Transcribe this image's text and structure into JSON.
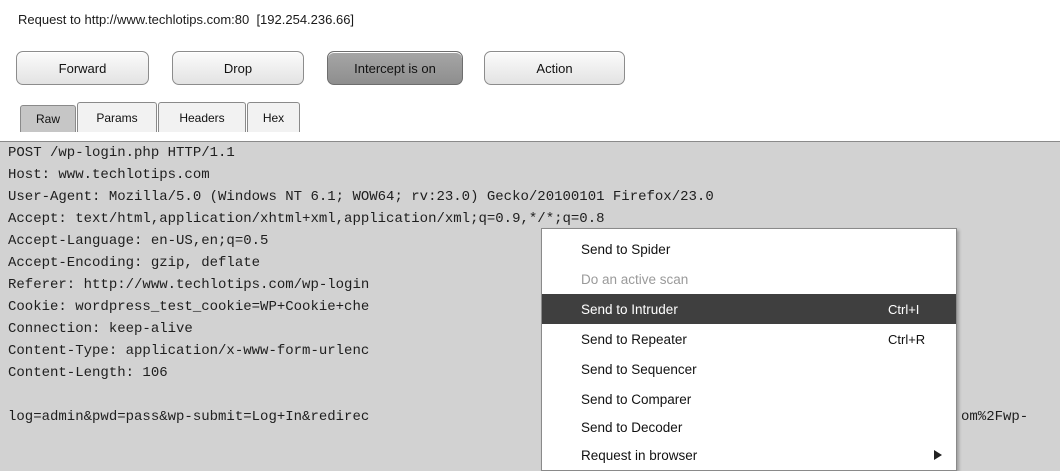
{
  "request_info": "Request to http://www.techlotips.com:80  [192.254.236.66]",
  "toolbar": {
    "forward": "Forward",
    "drop": "Drop",
    "intercept": "Intercept is on",
    "action": "Action"
  },
  "tabs": [
    "Raw",
    "Params",
    "Headers",
    "Hex"
  ],
  "active_tab": "Raw",
  "request_lines": [
    "POST /wp-login.php HTTP/1.1",
    "Host: www.techlotips.com",
    "User-Agent: Mozilla/5.0 (Windows NT 6.1; WOW64; rv:23.0) Gecko/20100101 Firefox/23.0",
    "Accept: text/html,application/xhtml+xml,application/xml;q=0.9,*/*;q=0.8",
    "Accept-Language: en-US,en;q=0.5",
    "Accept-Encoding: gzip, deflate",
    "Referer: http://www.techlotips.com/wp-login",
    "Cookie: wordpress_test_cookie=WP+Cookie+che",
    "Connection: keep-alive",
    "Content-Type: application/x-www-form-urlenc",
    "Content-Length: 106",
    "",
    "log=admin&pwd=pass&wp-submit=Log+In&redirec"
  ],
  "request_body_tail": "om%2Fwp-",
  "context_menu": {
    "items": [
      {
        "label": "Send to Spider",
        "shortcut": "",
        "state": "normal"
      },
      {
        "label": "Do an active scan",
        "shortcut": "",
        "state": "disabled"
      },
      {
        "label": "Send to Intruder",
        "shortcut": "Ctrl+I",
        "state": "highlight"
      },
      {
        "label": "Send to Repeater",
        "shortcut": "Ctrl+R",
        "state": "normal"
      },
      {
        "label": "Send to Sequencer",
        "shortcut": "",
        "state": "normal"
      },
      {
        "label": "Send to Comparer",
        "shortcut": "",
        "state": "normal"
      },
      {
        "label": "Send to Decoder",
        "shortcut": "",
        "state": "normal"
      },
      {
        "label": "Request in browser",
        "shortcut": "",
        "state": "submenu"
      }
    ]
  },
  "colors": {
    "editor_bg": "#d2d2d2",
    "highlight_bg": "#3f3f3f",
    "active_button_bg": "#999999"
  }
}
